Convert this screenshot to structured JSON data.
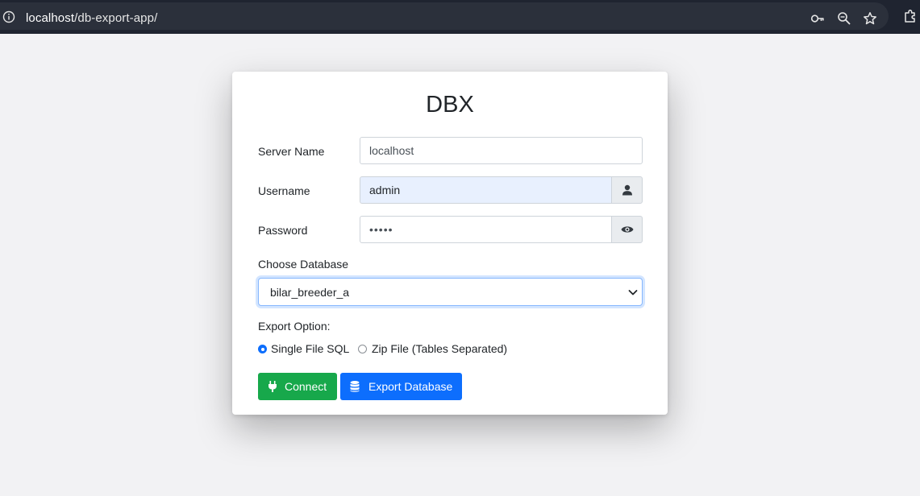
{
  "browser": {
    "url_host": "localhost",
    "url_path": "/db-export-app/",
    "icons": [
      "info-icon",
      "key-icon",
      "zoom-icon",
      "star-icon",
      "extensions-icon"
    ]
  },
  "card": {
    "title": "DBX",
    "fields": {
      "server_name": {
        "label": "Server Name",
        "value": "localhost"
      },
      "username": {
        "label": "Username",
        "value": "admin",
        "addon_icon": "user-icon"
      },
      "password": {
        "label": "Password",
        "value": "•••••",
        "addon_icon": "eye-icon"
      }
    },
    "database": {
      "label": "Choose Database",
      "selected": "bilar_breeder_a"
    },
    "export": {
      "label": "Export Option:",
      "options": [
        {
          "label": "Single File SQL",
          "checked": true
        },
        {
          "label": "Zip File (Tables Separated)",
          "checked": false
        }
      ]
    },
    "buttons": {
      "connect": {
        "label": "Connect",
        "icon": "plug-icon",
        "color": "#17a84b"
      },
      "export": {
        "label": "Export Database",
        "icon": "database-icon",
        "color": "#0d6efd"
      }
    }
  },
  "colors": {
    "primary": "#0d6efd",
    "success": "#17a84b",
    "autofill_bg": "#e8f0fe"
  }
}
